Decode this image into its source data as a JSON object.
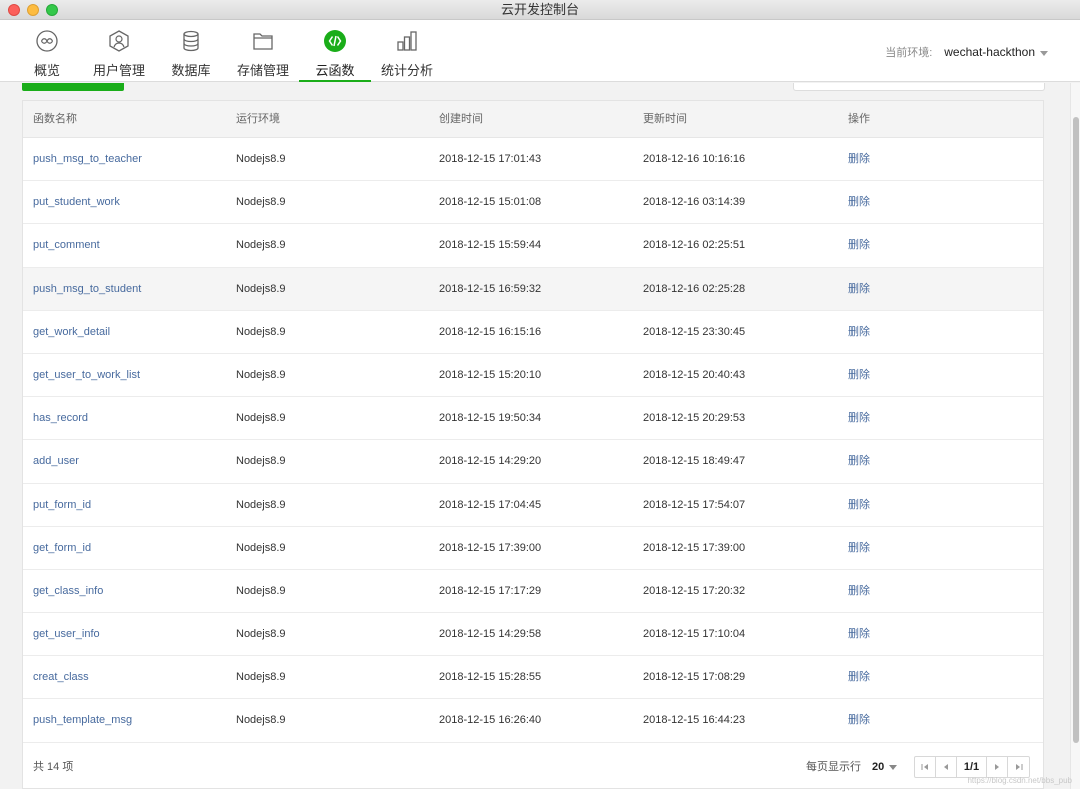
{
  "window": {
    "title": "云开发控制台"
  },
  "tabs": [
    {
      "label": "概览",
      "icon": "overview-icon"
    },
    {
      "label": "用户管理",
      "icon": "user-icon"
    },
    {
      "label": "数据库",
      "icon": "database-icon"
    },
    {
      "label": "存储管理",
      "icon": "folder-icon"
    },
    {
      "label": "云函数",
      "icon": "cloud-function-icon",
      "active": true
    },
    {
      "label": "统计分析",
      "icon": "stats-icon"
    }
  ],
  "env": {
    "label": "当前环境:",
    "value": "wechat-hackthon"
  },
  "table": {
    "headers": [
      "函数名称",
      "运行环境",
      "创建时间",
      "更新时间",
      "操作"
    ],
    "rows": [
      {
        "name": "push_msg_to_teacher",
        "runtime": "Nodejs8.9",
        "created": "2018-12-15 17:01:43",
        "updated": "2018-12-16 10:16:16",
        "action": "删除"
      },
      {
        "name": "put_student_work",
        "runtime": "Nodejs8.9",
        "created": "2018-12-15 15:01:08",
        "updated": "2018-12-16 03:14:39",
        "action": "删除"
      },
      {
        "name": "put_comment",
        "runtime": "Nodejs8.9",
        "created": "2018-12-15 15:59:44",
        "updated": "2018-12-16 02:25:51",
        "action": "删除"
      },
      {
        "name": "push_msg_to_student",
        "runtime": "Nodejs8.9",
        "created": "2018-12-15 16:59:32",
        "updated": "2018-12-16 02:25:28",
        "action": "删除"
      },
      {
        "name": "get_work_detail",
        "runtime": "Nodejs8.9",
        "created": "2018-12-15 16:15:16",
        "updated": "2018-12-15 23:30:45",
        "action": "删除"
      },
      {
        "name": "get_user_to_work_list",
        "runtime": "Nodejs8.9",
        "created": "2018-12-15 15:20:10",
        "updated": "2018-12-15 20:40:43",
        "action": "删除"
      },
      {
        "name": "has_record",
        "runtime": "Nodejs8.9",
        "created": "2018-12-15 19:50:34",
        "updated": "2018-12-15 20:29:53",
        "action": "删除"
      },
      {
        "name": "add_user",
        "runtime": "Nodejs8.9",
        "created": "2018-12-15 14:29:20",
        "updated": "2018-12-15 18:49:47",
        "action": "删除"
      },
      {
        "name": "put_form_id",
        "runtime": "Nodejs8.9",
        "created": "2018-12-15 17:04:45",
        "updated": "2018-12-15 17:54:07",
        "action": "删除"
      },
      {
        "name": "get_form_id",
        "runtime": "Nodejs8.9",
        "created": "2018-12-15 17:39:00",
        "updated": "2018-12-15 17:39:00",
        "action": "删除"
      },
      {
        "name": "get_class_info",
        "runtime": "Nodejs8.9",
        "created": "2018-12-15 17:17:29",
        "updated": "2018-12-15 17:20:32",
        "action": "删除"
      },
      {
        "name": "get_user_info",
        "runtime": "Nodejs8.9",
        "created": "2018-12-15 14:29:58",
        "updated": "2018-12-15 17:10:04",
        "action": "删除"
      },
      {
        "name": "creat_class",
        "runtime": "Nodejs8.9",
        "created": "2018-12-15 15:28:55",
        "updated": "2018-12-15 17:08:29",
        "action": "删除"
      },
      {
        "name": "push_template_msg",
        "runtime": "Nodejs8.9",
        "created": "2018-12-15 16:26:40",
        "updated": "2018-12-15 16:44:23",
        "action": "删除"
      }
    ]
  },
  "footer": {
    "total": "共 14 项",
    "per_page_label": "每页显示行",
    "per_page_value": "20",
    "page": "1/1"
  },
  "watermark": "https://blog.csdn.net/bbs_pub",
  "colors": {
    "accent": "#1aad19",
    "link": "#476a9e"
  }
}
